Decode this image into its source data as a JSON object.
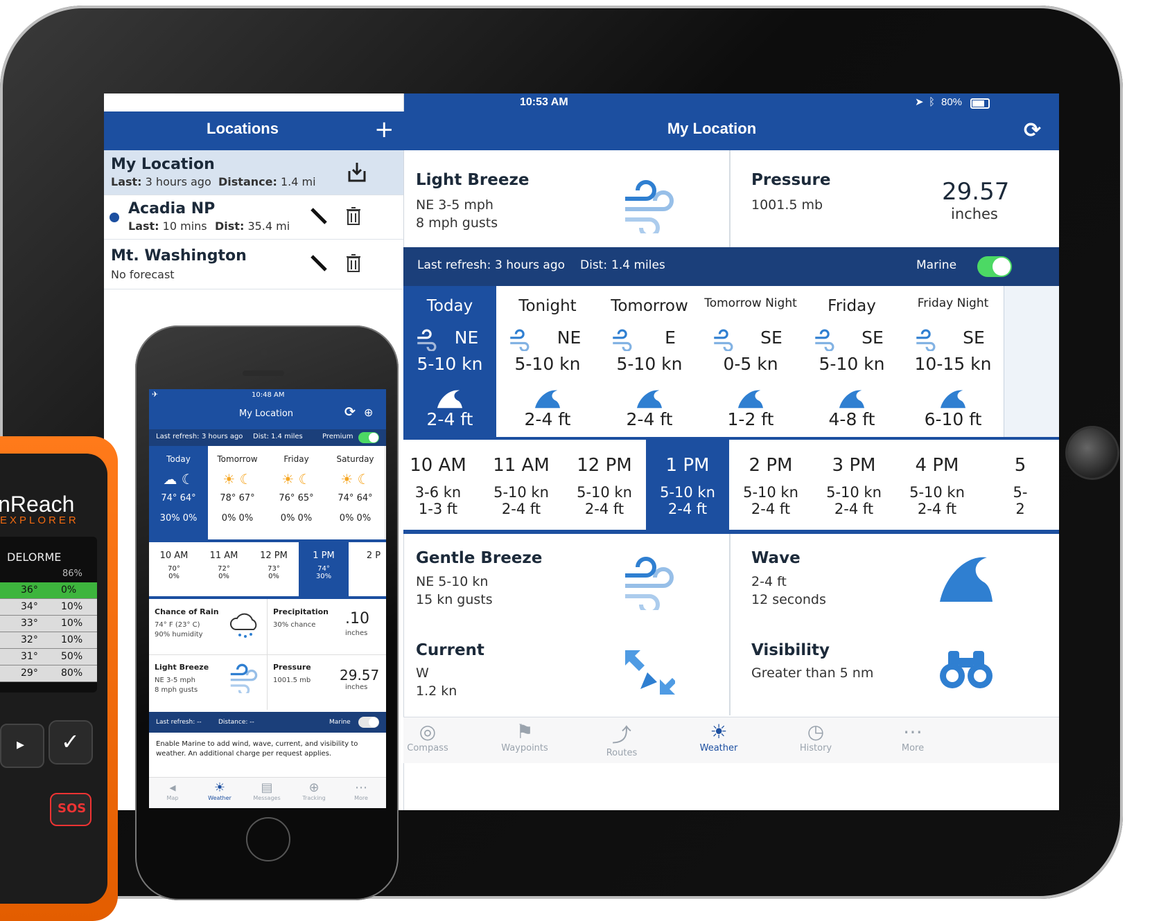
{
  "status_bar": {
    "time": "10:53 AM",
    "battery": "80%"
  },
  "sidebar": {
    "title": "Locations",
    "add_glyph": "+",
    "items": [
      {
        "name": "My Location",
        "last_label": "Last:",
        "last": "3 hours ago",
        "dist_label": "Distance:",
        "dist": "1.4 mi"
      },
      {
        "name": "Acadia NP",
        "last_label": "Last:",
        "last": "10 mins",
        "dist_label": "Dist:",
        "dist": "35.4 mi"
      },
      {
        "name": "Mt. Washington",
        "sub": "No forecast"
      }
    ]
  },
  "main": {
    "title": "My Location",
    "wind": {
      "title": "Light Breeze",
      "line1": "NE 3-5 mph",
      "line2": "8 mph gusts"
    },
    "pressure": {
      "title": "Pressure",
      "mb": "1001.5 mb",
      "value": "29.57",
      "unit": "inches"
    },
    "refresh_bar": {
      "last_label": "Last refresh:",
      "last": "3 hours ago",
      "dist_label": "Dist:",
      "dist": "1.4 miles",
      "marine": "Marine",
      "marine_on": true
    },
    "days": [
      {
        "name": "Today",
        "dir": "NE",
        "kn": "5-10 kn",
        "ft": "2-4 ft",
        "selected": true
      },
      {
        "name": "Tonight",
        "dir": "NE",
        "kn": "5-10 kn",
        "ft": "2-4 ft"
      },
      {
        "name": "Tomorrow",
        "dir": "E",
        "kn": "5-10 kn",
        "ft": "2-4 ft"
      },
      {
        "name": "Tomorrow Night",
        "dir": "SE",
        "kn": "0-5 kn",
        "ft": "1-2 ft"
      },
      {
        "name": "Friday",
        "dir": "SE",
        "kn": "5-10 kn",
        "ft": "4-8 ft"
      },
      {
        "name": "Friday Night",
        "dir": "SE",
        "kn": "10-15 kn",
        "ft": "6-10 ft"
      }
    ],
    "hours": [
      {
        "t": "10 AM",
        "k": "3-6 kn",
        "f": "1-3 ft"
      },
      {
        "t": "11 AM",
        "k": "5-10 kn",
        "f": "2-4 ft"
      },
      {
        "t": "12 PM",
        "k": "5-10 kn",
        "f": "2-4 ft"
      },
      {
        "t": "1 PM",
        "k": "5-10 kn",
        "f": "2-4 ft",
        "selected": true
      },
      {
        "t": "2 PM",
        "k": "5-10 kn",
        "f": "2-4 ft"
      },
      {
        "t": "3 PM",
        "k": "5-10 kn",
        "f": "2-4 ft"
      },
      {
        "t": "4 PM",
        "k": "5-10 kn",
        "f": "2-4 ft"
      },
      {
        "t": "5",
        "k": "5-",
        "f": "2"
      }
    ],
    "gentle": {
      "title": "Gentle Breeze",
      "line1": "NE 5-10 kn",
      "line2": "15 kn gusts"
    },
    "wave": {
      "title": "Wave",
      "line1": "2-4 ft",
      "line2": "12 seconds"
    },
    "current": {
      "title": "Current",
      "line1": "W",
      "line2": "1.2 kn"
    },
    "visibility": {
      "title": "Visibility",
      "line1": "Greater than 5 nm"
    },
    "tabs": [
      "Compass",
      "Waypoints",
      "Routes",
      "Weather",
      "History",
      "More"
    ],
    "active_tab": "Weather"
  },
  "phone": {
    "time": "10:48 AM",
    "title": "My Location",
    "refresh": {
      "last_label": "Last refresh:",
      "last": "3 hours ago",
      "dist_label": "Dist:",
      "dist": "1.4 miles",
      "premium": "Premium"
    },
    "days": [
      {
        "name": "Today",
        "hi": "74°",
        "lo": "64°",
        "p1": "30%",
        "p2": "0%"
      },
      {
        "name": "Tomorrow",
        "hi": "78°",
        "lo": "67°",
        "p1": "0%",
        "p2": "0%"
      },
      {
        "name": "Friday",
        "hi": "76°",
        "lo": "65°",
        "p1": "0%",
        "p2": "0%"
      },
      {
        "name": "Saturday",
        "hi": "74°",
        "lo": "64°",
        "p1": "0%",
        "p2": "0%"
      }
    ],
    "hours": [
      {
        "t": "10 AM",
        "temp": "70°",
        "p": "0%"
      },
      {
        "t": "11 AM",
        "temp": "72°",
        "p": "0%"
      },
      {
        "t": "12 PM",
        "temp": "73°",
        "p": "0%"
      },
      {
        "t": "1 PM",
        "temp": "74°",
        "p": "30%"
      },
      {
        "t": "2 P"
      }
    ],
    "rain": {
      "title": "Chance of Rain",
      "l1": "74° F (23° C)",
      "l2": "90% humidity"
    },
    "precip": {
      "title": "Precipitation",
      "l1": "30% chance",
      "value": ".10",
      "unit": "inches"
    },
    "breeze": {
      "title": "Light Breeze",
      "l1": "NE 3-5 mph",
      "l2": "8 mph gusts"
    },
    "pressure": {
      "title": "Pressure",
      "l1": "1001.5 mb",
      "value": "29.57",
      "unit": "inches"
    },
    "bar2": {
      "last": "Last refresh: --",
      "dist": "Distance: --",
      "marine": "Marine"
    },
    "note": "Enable Marine to add wind, wave, current, and visibility to weather. An additional charge per request applies.",
    "tabs": [
      "Map",
      "Weather",
      "Messages",
      "Tracking",
      "More"
    ]
  },
  "device": {
    "brand_a": "inReach",
    "brand_b": "EXPLORER",
    "maker": "DELORME",
    "battery": "86%",
    "rows": [
      {
        "t": "36°",
        "p": "0%"
      },
      {
        "t": "34°",
        "p": "10%"
      },
      {
        "t": "33°",
        "p": "10%"
      },
      {
        "t": "32°",
        "p": "10%"
      },
      {
        "t": "31°",
        "p": "50%"
      },
      {
        "t": "29°",
        "p": "80%"
      }
    ],
    "sos": "SOS"
  },
  "colors": {
    "navy": "#1c4fa0",
    "dark_navy": "#1b3f7a",
    "icon_blue": "#2f7fd1",
    "toggle_green": "#4cd964",
    "orange": "#f26a10"
  }
}
